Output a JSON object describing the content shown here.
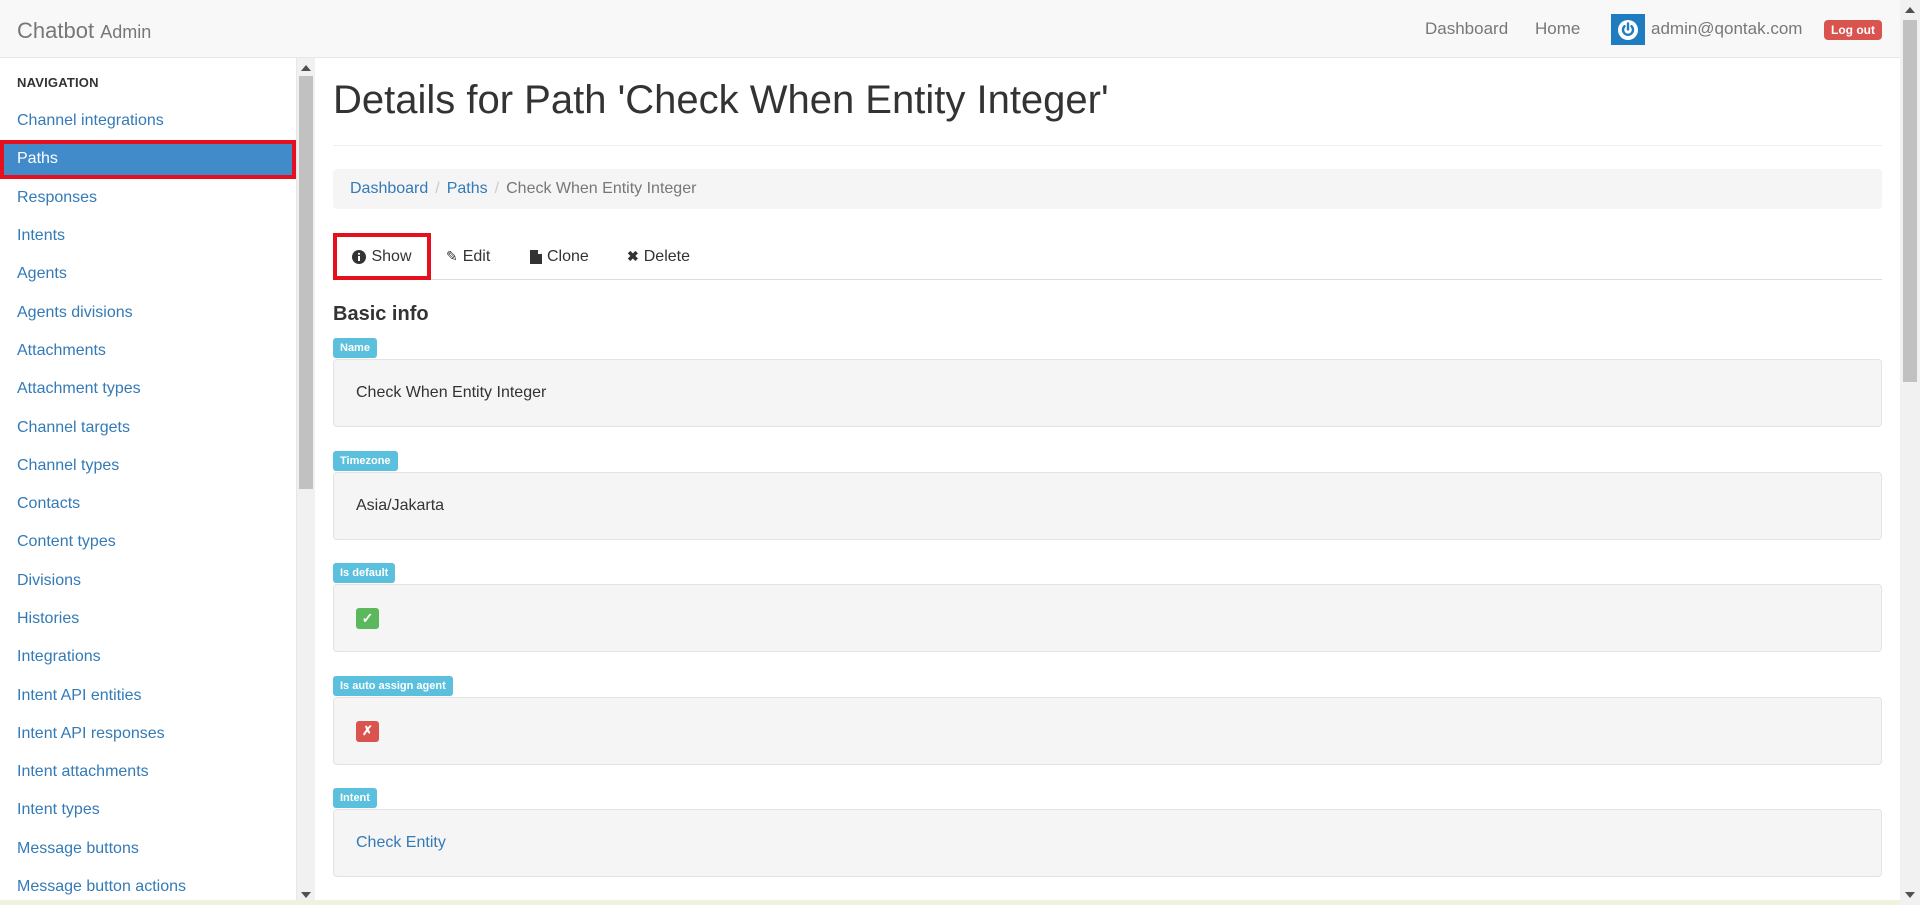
{
  "navbar": {
    "brand": "Chatbot",
    "brand_sub": "Admin",
    "links": [
      "Dashboard",
      "Home"
    ],
    "user_email": "admin@qontak.com",
    "logout_label": "Log out"
  },
  "sidebar": {
    "header": "NAVIGATION",
    "items": [
      {
        "label": "Channel integrations",
        "active": false
      },
      {
        "label": "Paths",
        "active": true
      },
      {
        "label": "Responses",
        "active": false
      },
      {
        "label": "Intents",
        "active": false
      },
      {
        "label": "Agents",
        "active": false
      },
      {
        "label": "Agents divisions",
        "active": false
      },
      {
        "label": "Attachments",
        "active": false
      },
      {
        "label": "Attachment types",
        "active": false
      },
      {
        "label": "Channel targets",
        "active": false
      },
      {
        "label": "Channel types",
        "active": false
      },
      {
        "label": "Contacts",
        "active": false
      },
      {
        "label": "Content types",
        "active": false
      },
      {
        "label": "Divisions",
        "active": false
      },
      {
        "label": "Histories",
        "active": false
      },
      {
        "label": "Integrations",
        "active": false
      },
      {
        "label": "Intent API entities",
        "active": false
      },
      {
        "label": "Intent API responses",
        "active": false
      },
      {
        "label": "Intent attachments",
        "active": false
      },
      {
        "label": "Intent types",
        "active": false
      },
      {
        "label": "Message buttons",
        "active": false
      },
      {
        "label": "Message button actions",
        "active": false
      }
    ]
  },
  "main": {
    "title": "Details for Path 'Check When Entity Integer'",
    "breadcrumb": {
      "links": [
        "Dashboard",
        "Paths"
      ],
      "current": "Check When Entity Integer"
    },
    "tabs": {
      "show": "Show",
      "edit": "Edit",
      "clone": "Clone",
      "delete": "Delete"
    },
    "section_title": "Basic info",
    "fields": {
      "name": {
        "label": "Name",
        "value": "Check When Entity Integer"
      },
      "timezone": {
        "label": "Timezone",
        "value": "Asia/Jakarta"
      },
      "is_default": {
        "label": "Is default",
        "value": "✓"
      },
      "is_auto_assign_agent": {
        "label": "Is auto assign agent",
        "value": "✗"
      },
      "intent": {
        "label": "Intent",
        "value": "Check Entity"
      }
    }
  },
  "colors": {
    "link": "#337ab7",
    "active_nav": "#428bca",
    "highlight_outline": "#e4101e",
    "label_info": "#5bc0de",
    "success": "#5cb85c",
    "danger": "#d9534f"
  }
}
